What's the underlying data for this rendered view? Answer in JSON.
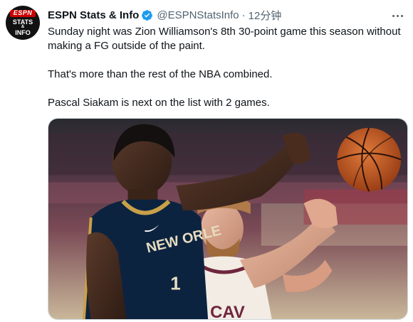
{
  "tweet": {
    "display_name": "ESPN Stats & Info",
    "handle": "@ESPNStatsInfo",
    "separator": "·",
    "timestamp": "12分钟",
    "paragraphs": [
      "Sunday night was Zion Williamson's 8th 30-point game this season without making a FG outside of the paint.",
      "That's more than the rest of the NBA combined.",
      "Pascal Siakam is next on the list with 2 games."
    ],
    "avatar": {
      "logo_word": "ESPN",
      "logo_line1": "STATS",
      "logo_amp": "&",
      "logo_line2": "INFO"
    },
    "media": {
      "jersey_text": "NEW ORLE",
      "jersey_number": "1",
      "jersey2_text": "CAV"
    }
  },
  "colors": {
    "verified": "#1d9bf0",
    "text_primary": "#0f1419",
    "text_secondary": "#536471",
    "avatar_bg": "#111111",
    "espn_red": "#cc0000",
    "pelicans_navy": "#0c2340",
    "pelicans_gold": "#c8a048",
    "cavs_wine": "#6f263d",
    "ball_orange": "#c8561f"
  },
  "icons": {
    "verified": "verified-badge-icon",
    "more": "more-horizontal-icon"
  }
}
